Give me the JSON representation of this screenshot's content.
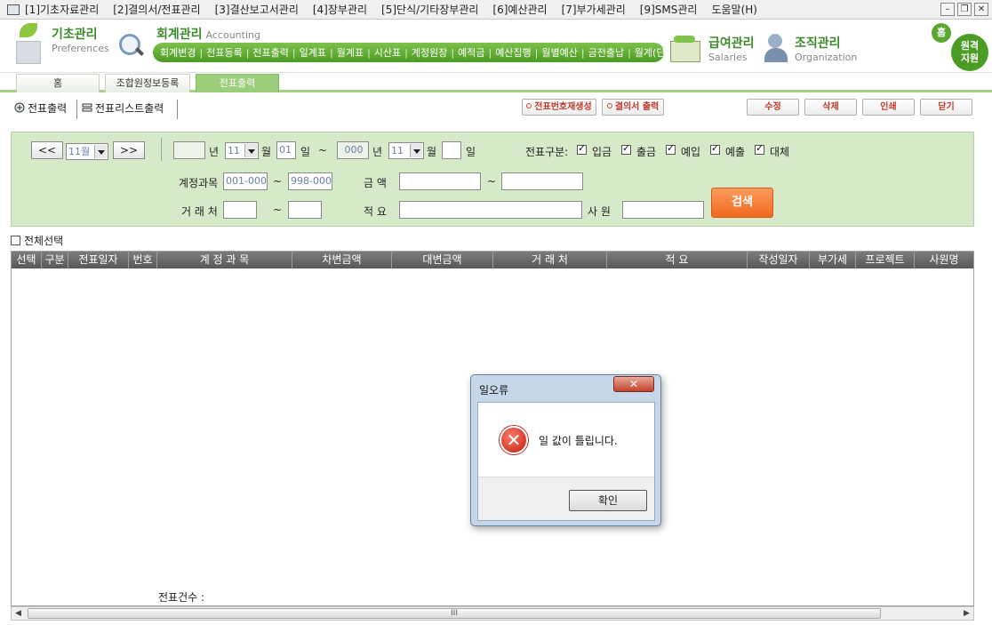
{
  "menu": {
    "items": [
      "[1]기초자료관리",
      "[2]결의서/전표관리",
      "[3]결산보고서관리",
      "[4]장부관리",
      "[5]단식/기타장부관리",
      "[6]예산관리",
      "[7]부가세관리",
      "[9]SMS관리",
      "도움말(H)"
    ],
    "min": "–",
    "restore": "❐",
    "close": "✕"
  },
  "header": {
    "basic": {
      "title": "기초관리",
      "sub": "Preferences"
    },
    "accounting": {
      "title": "회계관리",
      "sub": "Accounting"
    },
    "accounting_items": [
      "회계변경",
      "전표등록",
      "전표출력",
      "일계표",
      "월계표",
      "시산표",
      "계정원장",
      "예적금",
      "예산집행",
      "월별예산",
      "금전출납",
      "월계(단)"
    ],
    "salary": {
      "title": "급여관리",
      "sub": "Salaries"
    },
    "org": {
      "title": "조직관리",
      "sub": "Organization"
    },
    "home_badge": "홈",
    "remote_line1": "원격",
    "remote_line2": "지원"
  },
  "tabs": [
    "홈",
    "조합원정보등록",
    "전표출력"
  ],
  "subtabs": [
    "전표출력",
    "전표리스트출력"
  ],
  "top_buttons": {
    "renumber": "전표번호재생성",
    "resolution_print": "결의서 출력",
    "edit": "수정",
    "delete": "삭제",
    "print": "인쇄",
    "close": "닫기"
  },
  "search": {
    "prev": "<<",
    "next": ">>",
    "month_select": "11월",
    "year_label": "년",
    "from_month": "11",
    "month_label": "월",
    "from_day": "01",
    "day_label": "일",
    "tilde": "~",
    "to_year": "000",
    "to_month": "11",
    "voucher_type_label": "전표구분:",
    "types": [
      "입금",
      "출금",
      "예입",
      "예출",
      "대체"
    ],
    "account_label": "계정과목",
    "account_from": "001-000",
    "account_to": "998-000",
    "amount_label": "금   액",
    "client_label": "거 래 처",
    "summary_label": "적   요",
    "staff_label": "사   원",
    "search_button": "검색"
  },
  "grid": {
    "select_all": "전체선택",
    "headers": [
      "선택",
      "구분",
      "전표일자",
      "번호",
      "계 정 과 목",
      "차변금액",
      "대변금액",
      "거   래   처",
      "적      요",
      "작성일자",
      "부가세",
      "프로젝트",
      "사원명"
    ],
    "count_label": "전표건수 :",
    "scroll_grip": "III"
  },
  "dialog": {
    "title": "일오류",
    "message": "일 값이 틀립니다.",
    "ok": "확인",
    "close": "✕",
    "icon": "✕"
  }
}
